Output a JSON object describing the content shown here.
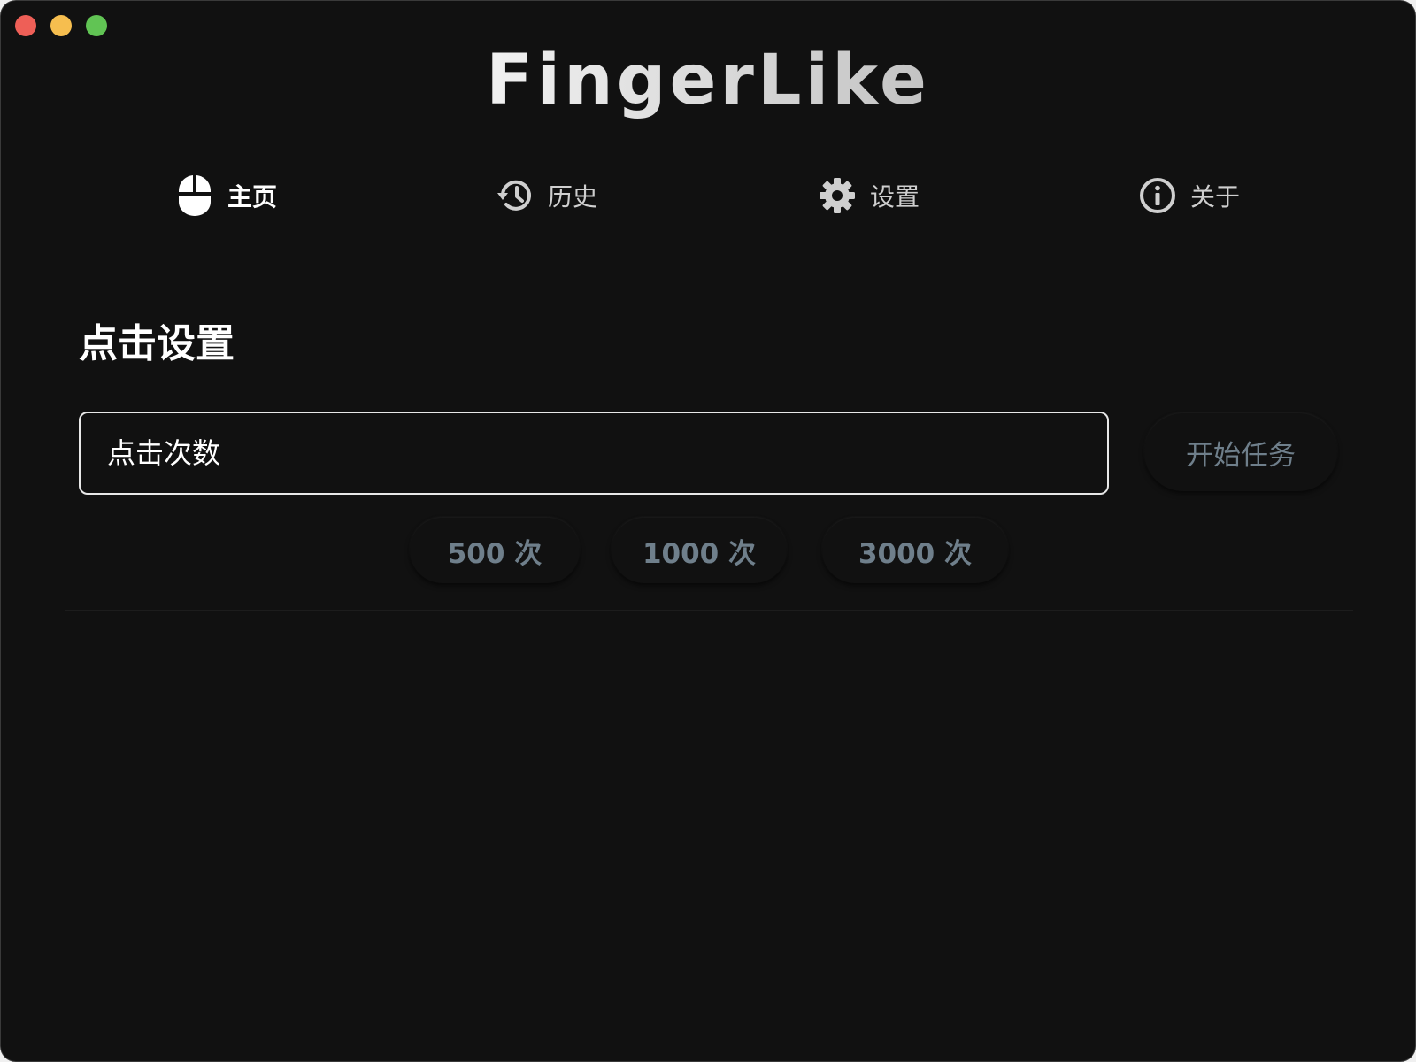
{
  "app": {
    "title": "FingerLike"
  },
  "window_controls": [
    "close",
    "minimize",
    "maximize"
  ],
  "nav": {
    "items": [
      {
        "id": "home",
        "label": "主页",
        "icon": "mouse-icon",
        "active": true
      },
      {
        "id": "history",
        "label": "历史",
        "icon": "history-icon",
        "active": false
      },
      {
        "id": "settings",
        "label": "设置",
        "icon": "gear-icon",
        "active": false
      },
      {
        "id": "about",
        "label": "关于",
        "icon": "info-icon",
        "active": false
      }
    ]
  },
  "main": {
    "section_title": "点击设置",
    "click_count_input": {
      "placeholder": "点击次数",
      "value": ""
    },
    "start_button_label": "开始任务",
    "presets": [
      "500 次",
      "1000 次",
      "3000 次"
    ]
  },
  "colors": {
    "background": "#111111",
    "muted_text": "#6f7f8b",
    "traffic_close": "#ee5f57",
    "traffic_minimize": "#f6be4f",
    "traffic_maximize": "#61c454"
  }
}
